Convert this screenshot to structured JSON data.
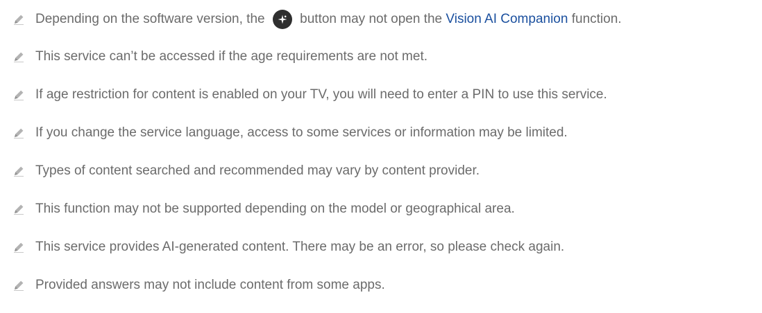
{
  "notes": [
    {
      "before": "Depending on the software version, the",
      "after": "button may not open the",
      "link": "Vision AI Companion",
      "end": "function."
    },
    {
      "text": "This service can’t be accessed if the age requirements are not met."
    },
    {
      "text": "If age restriction for content is enabled on your TV, you will need to enter a PIN to use this service."
    },
    {
      "text": "If you change the service language, access to some services or information may be limited."
    },
    {
      "text": "Types of content searched and recommended may vary by content provider."
    },
    {
      "text": "This function may not be supported depending on the model or geographical area."
    },
    {
      "text": "This service provides AI-generated content. There may be an error, so please check again."
    },
    {
      "text": "Provided answers may not include content from some apps."
    }
  ],
  "icons": {
    "note": "pencil-icon",
    "remote_button": "ai-button-icon"
  },
  "colors": {
    "text": "#6b6b6b",
    "link": "#1a4f9e",
    "icon": "#b3b3b3",
    "button": "#2f2f2f"
  }
}
